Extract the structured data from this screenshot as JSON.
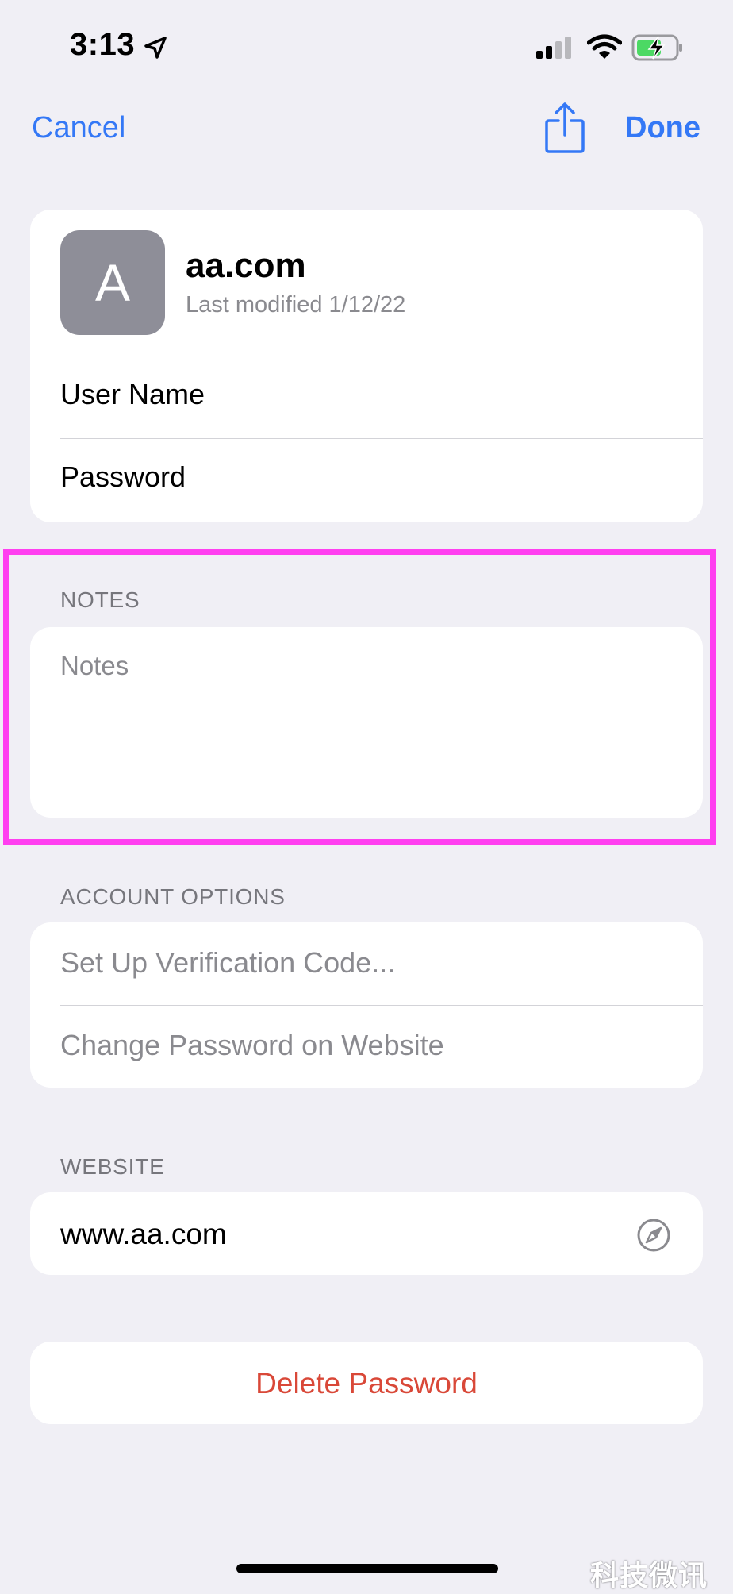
{
  "status_bar": {
    "time": "3:13",
    "icons": [
      "location-arrow-icon",
      "cellular-signal-icon",
      "wifi-icon",
      "battery-charging-icon"
    ]
  },
  "nav": {
    "cancel_label": "Cancel",
    "share_icon": "share-icon",
    "done_label": "Done",
    "accent_color": "#3478f6"
  },
  "account": {
    "avatar_letter": "A",
    "site": "aa.com",
    "last_modified": "Last modified 1/12/22",
    "rows": [
      {
        "label": "User Name"
      },
      {
        "label": "Password"
      }
    ]
  },
  "notes": {
    "header": "NOTES",
    "placeholder": "Notes",
    "highlight_color": "#ff3ff0"
  },
  "account_options": {
    "header": "ACCOUNT OPTIONS",
    "items": [
      {
        "label": "Set Up Verification Code..."
      },
      {
        "label": "Change Password on Website"
      }
    ]
  },
  "website": {
    "header": "WEBSITE",
    "url": "www.aa.com",
    "icon": "compass-icon"
  },
  "delete": {
    "label": "Delete Password",
    "color": "#d94838"
  },
  "watermark": "科技微讯"
}
